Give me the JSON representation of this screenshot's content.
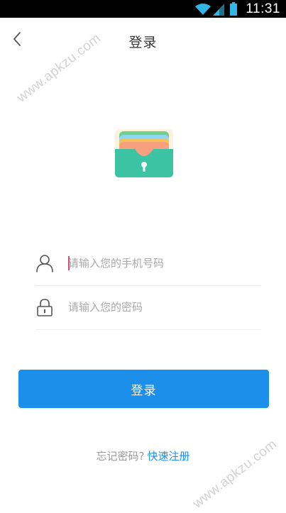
{
  "status_bar": {
    "time": "11:31",
    "icons": [
      "wifi-icon",
      "signal-icon",
      "battery-icon"
    ]
  },
  "header": {
    "back_icon": "chevron-left-icon",
    "title": "登录"
  },
  "watermark": {
    "text": "www.apkzu.com"
  },
  "logo": {
    "icon": "wallet-lock-icon"
  },
  "form": {
    "phone": {
      "placeholder": "请输入您的手机号码",
      "value": "",
      "icon": "user-icon"
    },
    "password": {
      "placeholder": "请输入您的密码",
      "value": "",
      "icon": "lock-icon"
    }
  },
  "login_button": {
    "label": "登录"
  },
  "footer": {
    "forgot_label": "忘记密码?",
    "register_label": "快速注册"
  },
  "colors": {
    "accent": "#1c8feb",
    "status_bar_bg": "#000000",
    "status_icon": "#33b5e5",
    "text_primary": "#333333",
    "text_placeholder": "#a9a9a9",
    "divider": "#eeeeee",
    "caret": "#e0457a",
    "logo_teal": "#3cc3a3"
  }
}
